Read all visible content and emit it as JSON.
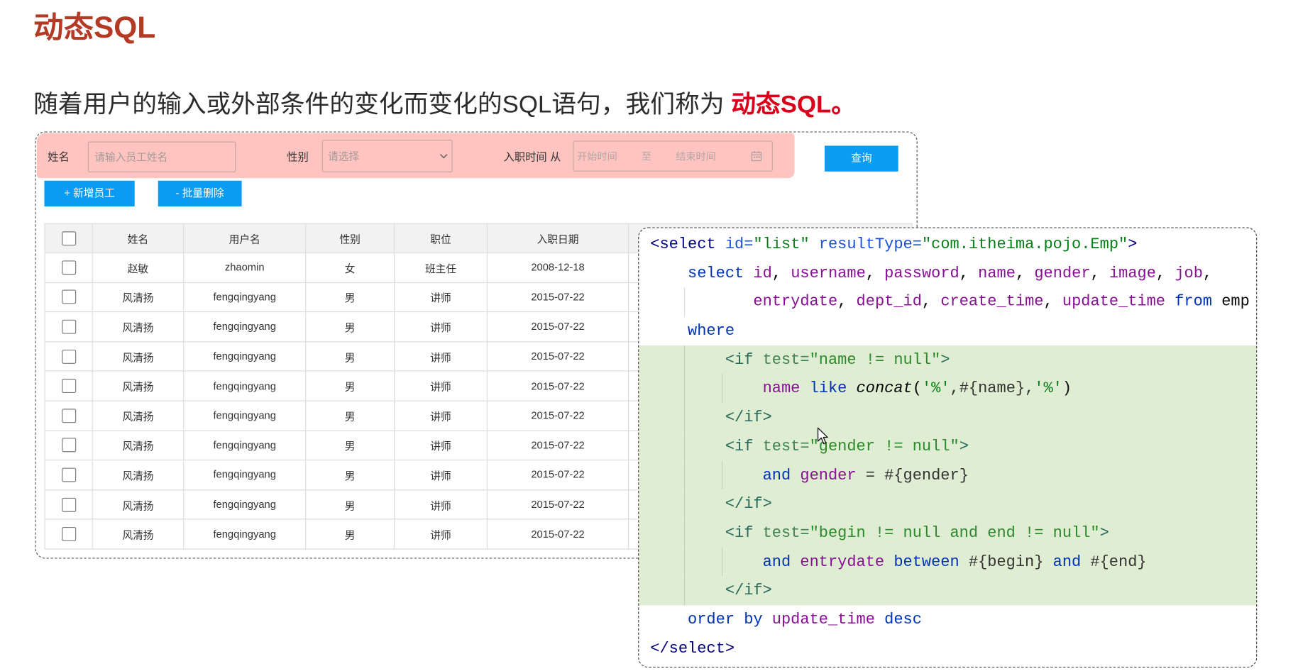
{
  "title": "动态SQL",
  "subtitle": {
    "text": "随着用户的输入或外部条件的变化而变化的SQL语句，我们称为 ",
    "highlight": "动态SQL。"
  },
  "theme": {
    "title_color": "#b33b26",
    "highlight_color": "#d9001b",
    "button_color": "#0a9cf5",
    "search_bar_color": "#ffc4bf",
    "code_highlight_color": "#dfedd3"
  },
  "search": {
    "name_label": "姓名",
    "name_placeholder": "请输入员工姓名",
    "gender_label": "性别",
    "gender_placeholder": "请选择",
    "date_label": "入职时间 从",
    "date_start_placeholder": "开始时间",
    "date_separator": "至",
    "date_end_placeholder": "结束时间",
    "query_button": "查询"
  },
  "actions": {
    "add": "+ 新增员工",
    "batch_delete": "- 批量删除"
  },
  "table": {
    "headers": [
      "姓名",
      "用户名",
      "性别",
      "职位",
      "入职日期"
    ],
    "rows": [
      {
        "name": "赵敏",
        "username": "zhaomin",
        "gender": "女",
        "job": "班主任",
        "entrydate": "2008-12-18"
      },
      {
        "name": "风清扬",
        "username": "fengqingyang",
        "gender": "男",
        "job": "讲师",
        "entrydate": "2015-07-22"
      },
      {
        "name": "风清扬",
        "username": "fengqingyang",
        "gender": "男",
        "job": "讲师",
        "entrydate": "2015-07-22"
      },
      {
        "name": "风清扬",
        "username": "fengqingyang",
        "gender": "男",
        "job": "讲师",
        "entrydate": "2015-07-22"
      },
      {
        "name": "风清扬",
        "username": "fengqingyang",
        "gender": "男",
        "job": "讲师",
        "entrydate": "2015-07-22"
      },
      {
        "name": "风清扬",
        "username": "fengqingyang",
        "gender": "男",
        "job": "讲师",
        "entrydate": "2015-07-22"
      },
      {
        "name": "风清扬",
        "username": "fengqingyang",
        "gender": "男",
        "job": "讲师",
        "entrydate": "2015-07-22"
      },
      {
        "name": "风清扬",
        "username": "fengqingyang",
        "gender": "男",
        "job": "讲师",
        "entrydate": "2015-07-22"
      },
      {
        "name": "风清扬",
        "username": "fengqingyang",
        "gender": "男",
        "job": "讲师",
        "entrydate": "2015-07-22"
      },
      {
        "name": "风清扬",
        "username": "fengqingyang",
        "gender": "男",
        "job": "讲师",
        "entrydate": "2015-07-22"
      }
    ]
  },
  "code": {
    "lines": [
      {
        "highlight": false,
        "tokens": [
          {
            "text": "<select",
            "color": "#000080"
          },
          {
            "text": " id=",
            "color": "#1a4fd6"
          },
          {
            "text": "\"list\"",
            "color": "#067d17"
          },
          {
            "text": " resultType=",
            "color": "#1a4fd6"
          },
          {
            "text": "\"com.itheima.pojo.Emp\"",
            "color": "#067d17"
          },
          {
            "text": ">",
            "color": "#000080"
          }
        ]
      },
      {
        "highlight": false,
        "tokens": [
          {
            "text": "    select ",
            "color": "#0033b3"
          },
          {
            "text": "id",
            "color": "#871094"
          },
          {
            "text": ", ",
            "color": "#080808"
          },
          {
            "text": "username",
            "color": "#871094"
          },
          {
            "text": ", ",
            "color": "#080808"
          },
          {
            "text": "password",
            "color": "#871094"
          },
          {
            "text": ", ",
            "color": "#080808"
          },
          {
            "text": "name",
            "color": "#871094"
          },
          {
            "text": ", ",
            "color": "#080808"
          },
          {
            "text": "gender",
            "color": "#871094"
          },
          {
            "text": ", ",
            "color": "#080808"
          },
          {
            "text": "image",
            "color": "#871094"
          },
          {
            "text": ", ",
            "color": "#080808"
          },
          {
            "text": "job",
            "color": "#871094"
          },
          {
            "text": ",",
            "color": "#080808"
          }
        ]
      },
      {
        "highlight": false,
        "tokens": [
          {
            "text": "           entrydate",
            "color": "#871094"
          },
          {
            "text": ", ",
            "color": "#080808"
          },
          {
            "text": "dept_id",
            "color": "#871094"
          },
          {
            "text": ", ",
            "color": "#080808"
          },
          {
            "text": "create_time",
            "color": "#871094"
          },
          {
            "text": ", ",
            "color": "#080808"
          },
          {
            "text": "update_time",
            "color": "#871094"
          },
          {
            "text": " from ",
            "color": "#0033b3"
          },
          {
            "text": "emp",
            "color": "#080808"
          }
        ]
      },
      {
        "highlight": false,
        "tokens": [
          {
            "text": "    where",
            "color": "#0033b3"
          }
        ]
      },
      {
        "highlight": true,
        "tokens": [
          {
            "text": "        <if",
            "color": "#26685a"
          },
          {
            "text": " test=",
            "color": "#3d8250"
          },
          {
            "text": "\"name != null\"",
            "color": "#2a8a2a"
          },
          {
            "text": ">",
            "color": "#26685a"
          }
        ]
      },
      {
        "highlight": true,
        "tokens": [
          {
            "text": "            name",
            "color": "#871094"
          },
          {
            "text": " like ",
            "color": "#0033b3"
          },
          {
            "text": "concat",
            "color": "#000000",
            "italic": true
          },
          {
            "text": "(",
            "color": "#080808"
          },
          {
            "text": "'%'",
            "color": "#067d17"
          },
          {
            "text": ",#{name},",
            "color": "#333333"
          },
          {
            "text": "'%'",
            "color": "#067d17"
          },
          {
            "text": ")",
            "color": "#080808"
          }
        ]
      },
      {
        "highlight": true,
        "tokens": [
          {
            "text": "        </if>",
            "color": "#26685a"
          }
        ]
      },
      {
        "highlight": true,
        "tokens": [
          {
            "text": "        <if",
            "color": "#26685a"
          },
          {
            "text": " test=",
            "color": "#3d8250"
          },
          {
            "text": "\"gender != null\"",
            "color": "#2a8a2a"
          },
          {
            "text": ">",
            "color": "#26685a"
          }
        ]
      },
      {
        "highlight": true,
        "tokens": [
          {
            "text": "            and ",
            "color": "#0033b3"
          },
          {
            "text": "gender",
            "color": "#871094"
          },
          {
            "text": " = #{gender}",
            "color": "#333333"
          }
        ]
      },
      {
        "highlight": true,
        "tokens": [
          {
            "text": "        </if>",
            "color": "#26685a"
          }
        ]
      },
      {
        "highlight": true,
        "tokens": [
          {
            "text": "        <if",
            "color": "#26685a"
          },
          {
            "text": " test=",
            "color": "#3d8250"
          },
          {
            "text": "\"begin != null and end != null\"",
            "color": "#2a8a2a"
          },
          {
            "text": ">",
            "color": "#26685a"
          }
        ]
      },
      {
        "highlight": true,
        "tokens": [
          {
            "text": "            and ",
            "color": "#0033b3"
          },
          {
            "text": "entrydate",
            "color": "#871094"
          },
          {
            "text": " between ",
            "color": "#0033b3"
          },
          {
            "text": "#{begin} ",
            "color": "#333333"
          },
          {
            "text": "and",
            "color": "#0033b3"
          },
          {
            "text": " #{end}",
            "color": "#333333"
          }
        ]
      },
      {
        "highlight": true,
        "tokens": [
          {
            "text": "        </if>",
            "color": "#26685a"
          }
        ]
      },
      {
        "highlight": false,
        "tokens": [
          {
            "text": "    order by ",
            "color": "#0033b3"
          },
          {
            "text": "update_time",
            "color": "#871094"
          },
          {
            "text": " desc",
            "color": "#0033b3"
          }
        ]
      },
      {
        "highlight": false,
        "tokens": [
          {
            "text": "</select>",
            "color": "#000080"
          }
        ]
      }
    ]
  }
}
